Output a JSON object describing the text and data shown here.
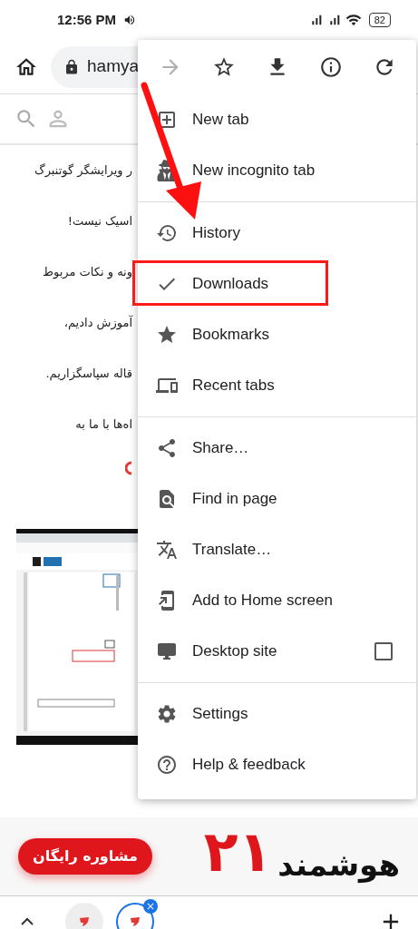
{
  "status_bar": {
    "time": "12:56 PM",
    "battery": "82"
  },
  "address_bar": {
    "url": "hamya"
  },
  "article": {
    "lines": [
      "ر ویرایشگر گوتنبرگ",
      "اسیک نیست!",
      "ونه و نکات مربوط",
      "آموزش دادیم،",
      "قاله سپاسگزاریم.",
      "اه‌ها با ما به"
    ]
  },
  "banner": {
    "button": "مشاوره رایگان",
    "number": "۲۱",
    "title": "هوشمند"
  },
  "tab_strip": {
    "tabs": [
      {
        "selected": false
      },
      {
        "selected": true
      }
    ]
  },
  "menu": {
    "toolbar": [
      {
        "disabled": true
      },
      {
        "disabled": false
      },
      {
        "disabled": false
      },
      {
        "disabled": false
      },
      {
        "disabled": false
      }
    ],
    "groups": [
      {
        "items": [
          {
            "kind": "item",
            "label": "New tab",
            "highlighted": false
          },
          {
            "kind": "item",
            "label": "New incognito tab",
            "highlighted": false
          }
        ]
      },
      {
        "items": [
          {
            "kind": "item",
            "label": "History",
            "highlighted": false
          },
          {
            "kind": "item",
            "label": "Downloads",
            "highlighted": true
          },
          {
            "kind": "item",
            "label": "Bookmarks",
            "highlighted": false
          },
          {
            "kind": "item",
            "label": "Recent tabs",
            "highlighted": false
          }
        ]
      },
      {
        "items": [
          {
            "kind": "item",
            "label": "Share…",
            "highlighted": false
          },
          {
            "kind": "item",
            "label": "Find in page",
            "highlighted": false
          },
          {
            "kind": "item",
            "label": "Translate…",
            "highlighted": false
          },
          {
            "kind": "item",
            "label": "Add to Home screen",
            "highlighted": false
          },
          {
            "kind": "checkbox",
            "label": "Desktop site",
            "checked": false,
            "highlighted": false
          }
        ]
      },
      {
        "items": [
          {
            "kind": "item",
            "label": "Settings",
            "highlighted": false
          },
          {
            "kind": "item",
            "label": "Help & feedback",
            "highlighted": false
          }
        ]
      }
    ]
  }
}
